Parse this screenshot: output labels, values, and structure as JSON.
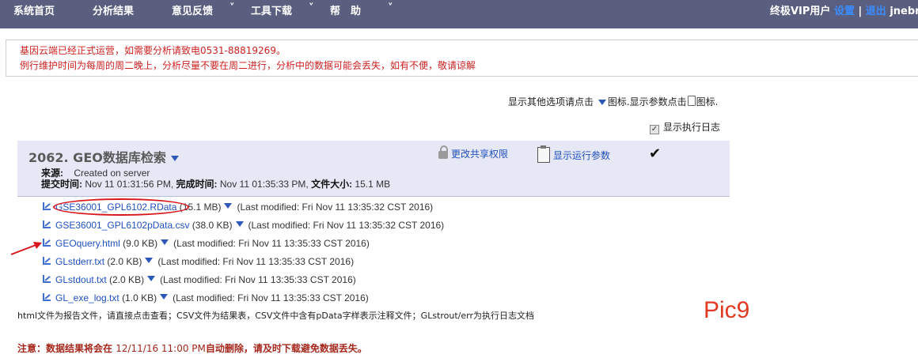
{
  "topnav": {
    "items": [
      {
        "label": "系统首页",
        "has_dropdown": false
      },
      {
        "label": "分析结果",
        "has_dropdown": false
      },
      {
        "label": "意见反馈",
        "has_dropdown": true
      },
      {
        "label": "工具下载",
        "has_dropdown": true
      },
      {
        "label": "帮　助",
        "has_dropdown": true
      }
    ],
    "chevron": "˅",
    "vip_label": "终极VIP用户",
    "settings_link": "设置",
    "separator": "|",
    "logout_link": "退出",
    "username": "jnebn"
  },
  "notice": {
    "line1": "基因云端已经正式运营，如需要分析请致电0531-88819269。",
    "line2": "例行维护时间为每周的周二晚上，分析尽量不要在周二进行，分析中的数据可能会丢失，如有不便，敬请谅解"
  },
  "options": {
    "text_a": "显示其他选项请点击",
    "text_b": "图标.显示参数点击",
    "text_c": "图标.",
    "log_label": "显示执行日志",
    "log_checked": true,
    "checkbox_mark": "✓"
  },
  "job": {
    "title": "2062. GEO数据库检索",
    "share_label": "更改共享权限",
    "params_label": "显示运行参数",
    "status_mark": "✔",
    "source_label": "来源:",
    "source_value": "Created on server",
    "submit_label": "提交时间:",
    "submit_value": "Nov 11 01:31:56 PM,",
    "complete_label": "完成时间:",
    "complete_value": "Nov 11 01:35:33 PM,",
    "size_label": "文件大小:",
    "size_value": "15.1 MB"
  },
  "files": [
    {
      "name": "GSE36001_GPL6102.RData",
      "size": "(15.1 MB)",
      "modified": "(Last modified: Fri Nov 11 13:35:32 CST 2016)"
    },
    {
      "name": "GSE36001_GPL6102pData.csv",
      "size": "(38.0 KB)",
      "modified": "(Last modified: Fri Nov 11 13:35:32 CST 2016)"
    },
    {
      "name": "GEOquery.html",
      "size": "(9.0 KB)",
      "modified": "(Last modified: Fri Nov 11 13:35:33 CST 2016)"
    },
    {
      "name": "GLstderr.txt",
      "size": "(2.0 KB)",
      "modified": "(Last modified: Fri Nov 11 13:35:33 CST 2016)"
    },
    {
      "name": "GLstdout.txt",
      "size": "(2.0 KB)",
      "modified": "(Last modified: Fri Nov 11 13:35:33 CST 2016)"
    },
    {
      "name": "GL_exe_log.txt",
      "size": "(1.0 KB)",
      "modified": "(Last modified: Fri Nov 11 13:35:33 CST 2016)"
    }
  ],
  "help_text": "html文件为报告文件，请直接点击查看；CSV文件为结果表，CSV文件中含有pData字样表示注释文件；GLstrout/err为执行日志文档",
  "pic_label": "Pic9",
  "warning": {
    "prefix": "注意：数据结果将会在",
    "datetime": "12/11/16 11:00 PM",
    "suffix": "自动删除，请及时下载避免数据丢失。"
  },
  "colors": {
    "nav_bg": "#5a5e7f",
    "link": "#2050c0",
    "notice_text": "#cc2222",
    "panel_bg": "#e6e8f5",
    "annotation_red": "#d9141a"
  }
}
